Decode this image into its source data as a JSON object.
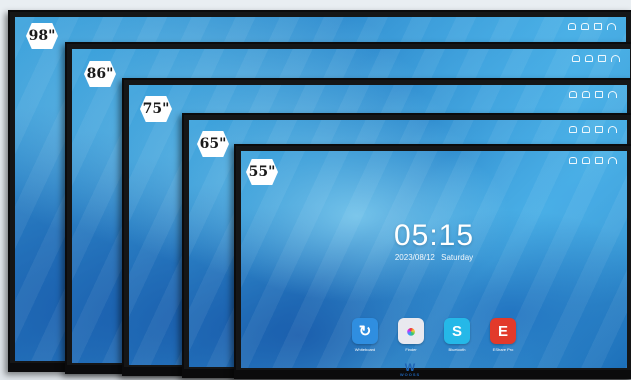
{
  "sizes": [
    "98\"",
    "86\"",
    "75\"",
    "65\"",
    "55\""
  ],
  "clock": {
    "time": "05:15",
    "date": "2023/08/12",
    "day": "Saturday"
  },
  "apps": [
    {
      "label": "Whiteboard",
      "icon": "whiteboard-icon",
      "color": "#2f8ee0",
      "glyph": "↻"
    },
    {
      "label": "Finder",
      "icon": "finder-icon",
      "color": "#e9e9ef",
      "glyph": "●"
    },
    {
      "label": "Bluetooth",
      "icon": "bluetooth-share-icon",
      "color": "#25b8e8",
      "glyph": "S"
    },
    {
      "label": "EShare Pro",
      "icon": "eshare-icon",
      "color": "#e23a2b",
      "glyph": "E"
    }
  ],
  "status_icons": [
    "hotspot-icon",
    "network-icon",
    "camera-icon",
    "wifi-icon"
  ],
  "brand": {
    "name": "W",
    "sub": "WOOSS",
    "color": "#1e63b5"
  }
}
